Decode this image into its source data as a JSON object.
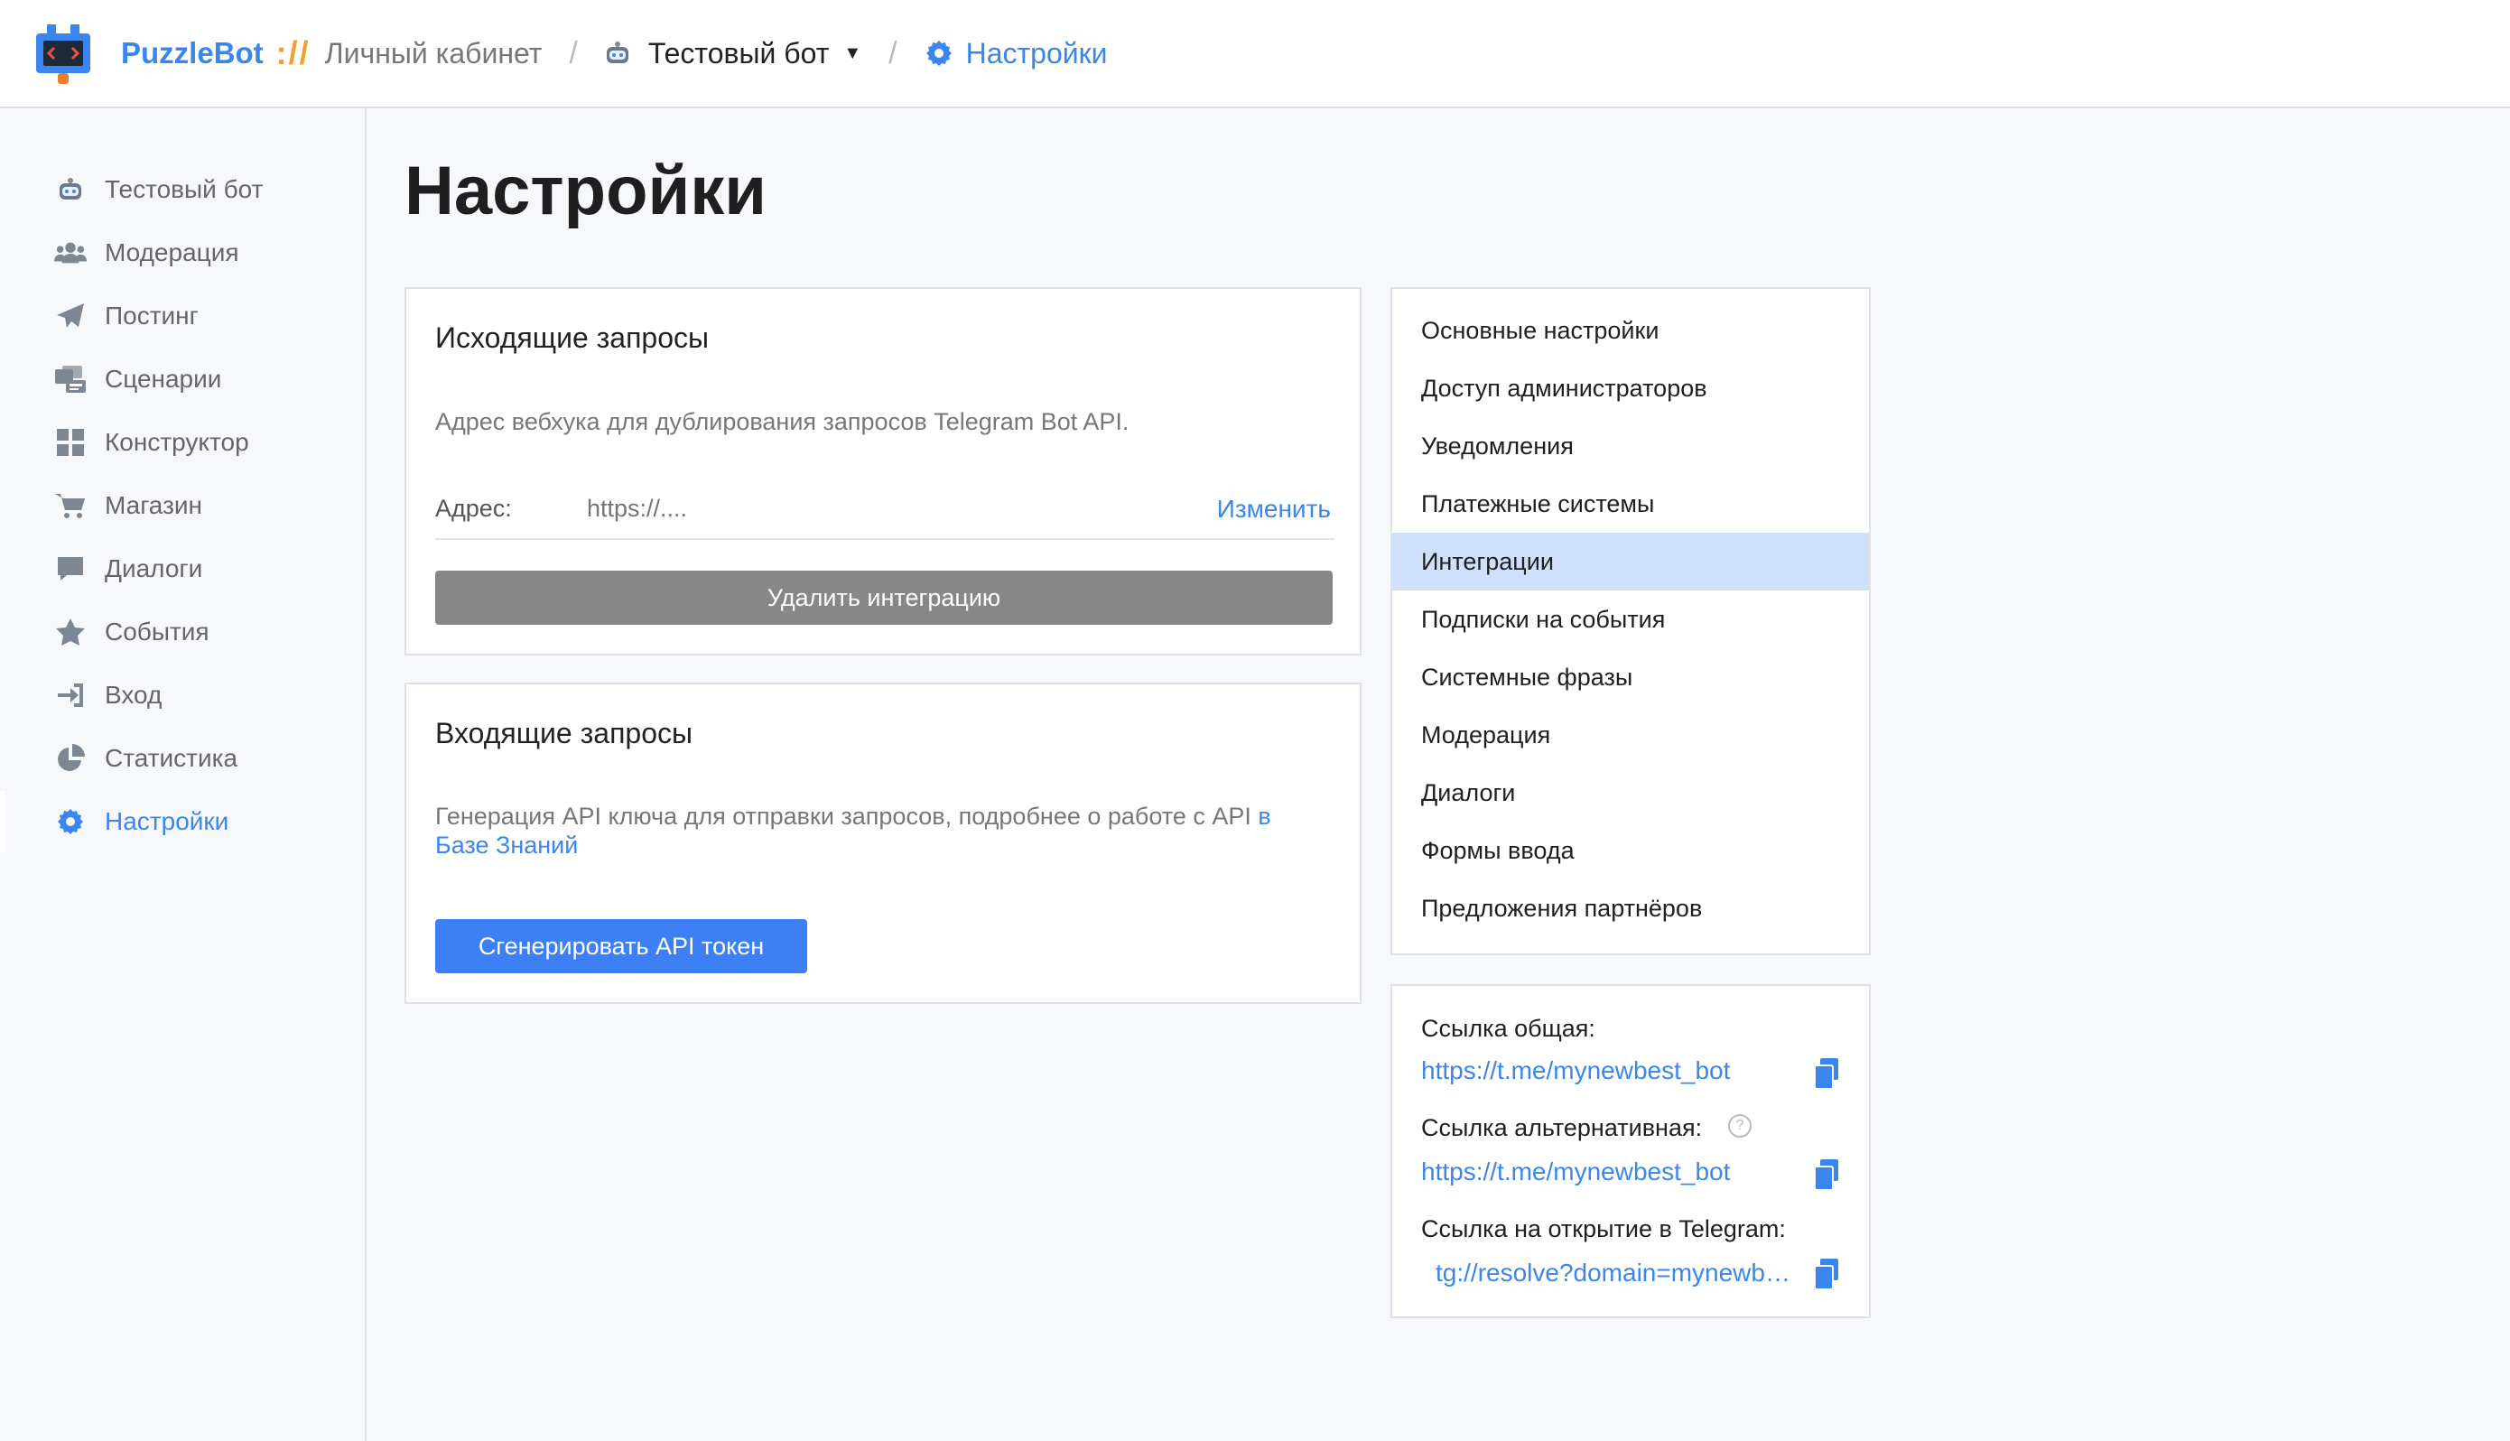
{
  "header": {
    "brand": "PuzzleBot",
    "brand_sep": "://",
    "cabinet": "Личный кабинет",
    "bot_name": "Тестовый бот",
    "current": "Настройки"
  },
  "sidebar": {
    "items": [
      {
        "label": "Тестовый бот",
        "icon": "bot-icon"
      },
      {
        "label": "Модерация",
        "icon": "users-icon"
      },
      {
        "label": "Постинг",
        "icon": "paper-plane-icon"
      },
      {
        "label": "Сценарии",
        "icon": "scenarios-icon"
      },
      {
        "label": "Конструктор",
        "icon": "grid-icon"
      },
      {
        "label": "Магазин",
        "icon": "cart-icon"
      },
      {
        "label": "Диалоги",
        "icon": "chat-icon"
      },
      {
        "label": "События",
        "icon": "star-icon"
      },
      {
        "label": "Вход",
        "icon": "sign-in-icon"
      },
      {
        "label": "Статистика",
        "icon": "pie-chart-icon"
      },
      {
        "label": "Настройки",
        "icon": "gear-icon"
      }
    ],
    "active_index": 10
  },
  "main": {
    "title": "Настройки",
    "outgoing": {
      "title": "Исходящие запросы",
      "description": "Адрес вебхука для дублирования запросов Telegram Bot API.",
      "address_label": "Адрес:",
      "address_placeholder": "https://....",
      "change_label": "Изменить",
      "delete_button": "Удалить интеграцию"
    },
    "incoming": {
      "title": "Входящие запросы",
      "description": "Генерация API ключа для отправки запросов, подробнее о работе с API ",
      "kb_link_line1": "в",
      "kb_link_line2": "Базе Знаний",
      "generate_button": "Сгенерировать API токен"
    }
  },
  "settings_menu": {
    "items": [
      "Основные настройки",
      "Доступ администраторов",
      "Уведомления",
      "Платежные системы",
      "Интеграции",
      "Подписки на события",
      "Системные фразы",
      "Модерация",
      "Диалоги",
      "Формы ввода",
      "Предложения партнёров"
    ],
    "selected_index": 4
  },
  "links": {
    "general_label": "Ссылка общая:",
    "general_url": "https://t.me/mynewbest_bot",
    "alt_label": "Ссылка альтернативная:",
    "alt_url": "https://t.me/mynewbest_bot",
    "tg_label": "Ссылка на открытие в Telegram:",
    "tg_url": "tg://resolve?domain=mynewbest_bot",
    "help_glyph": "?"
  },
  "colors": {
    "accent": "#3b86ee",
    "selected_bg": "#cfe0fd",
    "gray_button": "#878787",
    "blue_button": "#3d80f5"
  }
}
